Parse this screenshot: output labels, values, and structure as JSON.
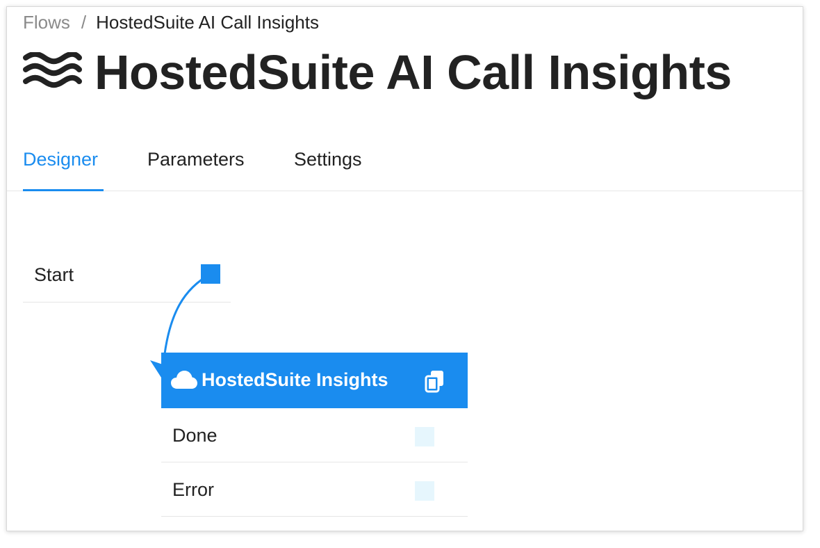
{
  "breadcrumb": {
    "parent": "Flows",
    "separator": "/",
    "current": "HostedSuite AI Call Insights"
  },
  "page": {
    "title": "HostedSuite AI Call Insights",
    "icon": "waves-icon"
  },
  "tabs": [
    {
      "label": "Designer",
      "active": true
    },
    {
      "label": "Parameters",
      "active": false
    },
    {
      "label": "Settings",
      "active": false
    }
  ],
  "designer": {
    "start_node": {
      "label": "Start"
    },
    "action_node": {
      "title": "HostedSuite Insights",
      "icon": "cloud-icon",
      "action_icon": "copy-icon",
      "outputs": [
        {
          "label": "Done"
        },
        {
          "label": "Error"
        }
      ]
    }
  },
  "colors": {
    "accent": "#1a8cef",
    "text": "#222222",
    "muted": "#8a8a8a",
    "output_port": "#e6f6fd"
  }
}
